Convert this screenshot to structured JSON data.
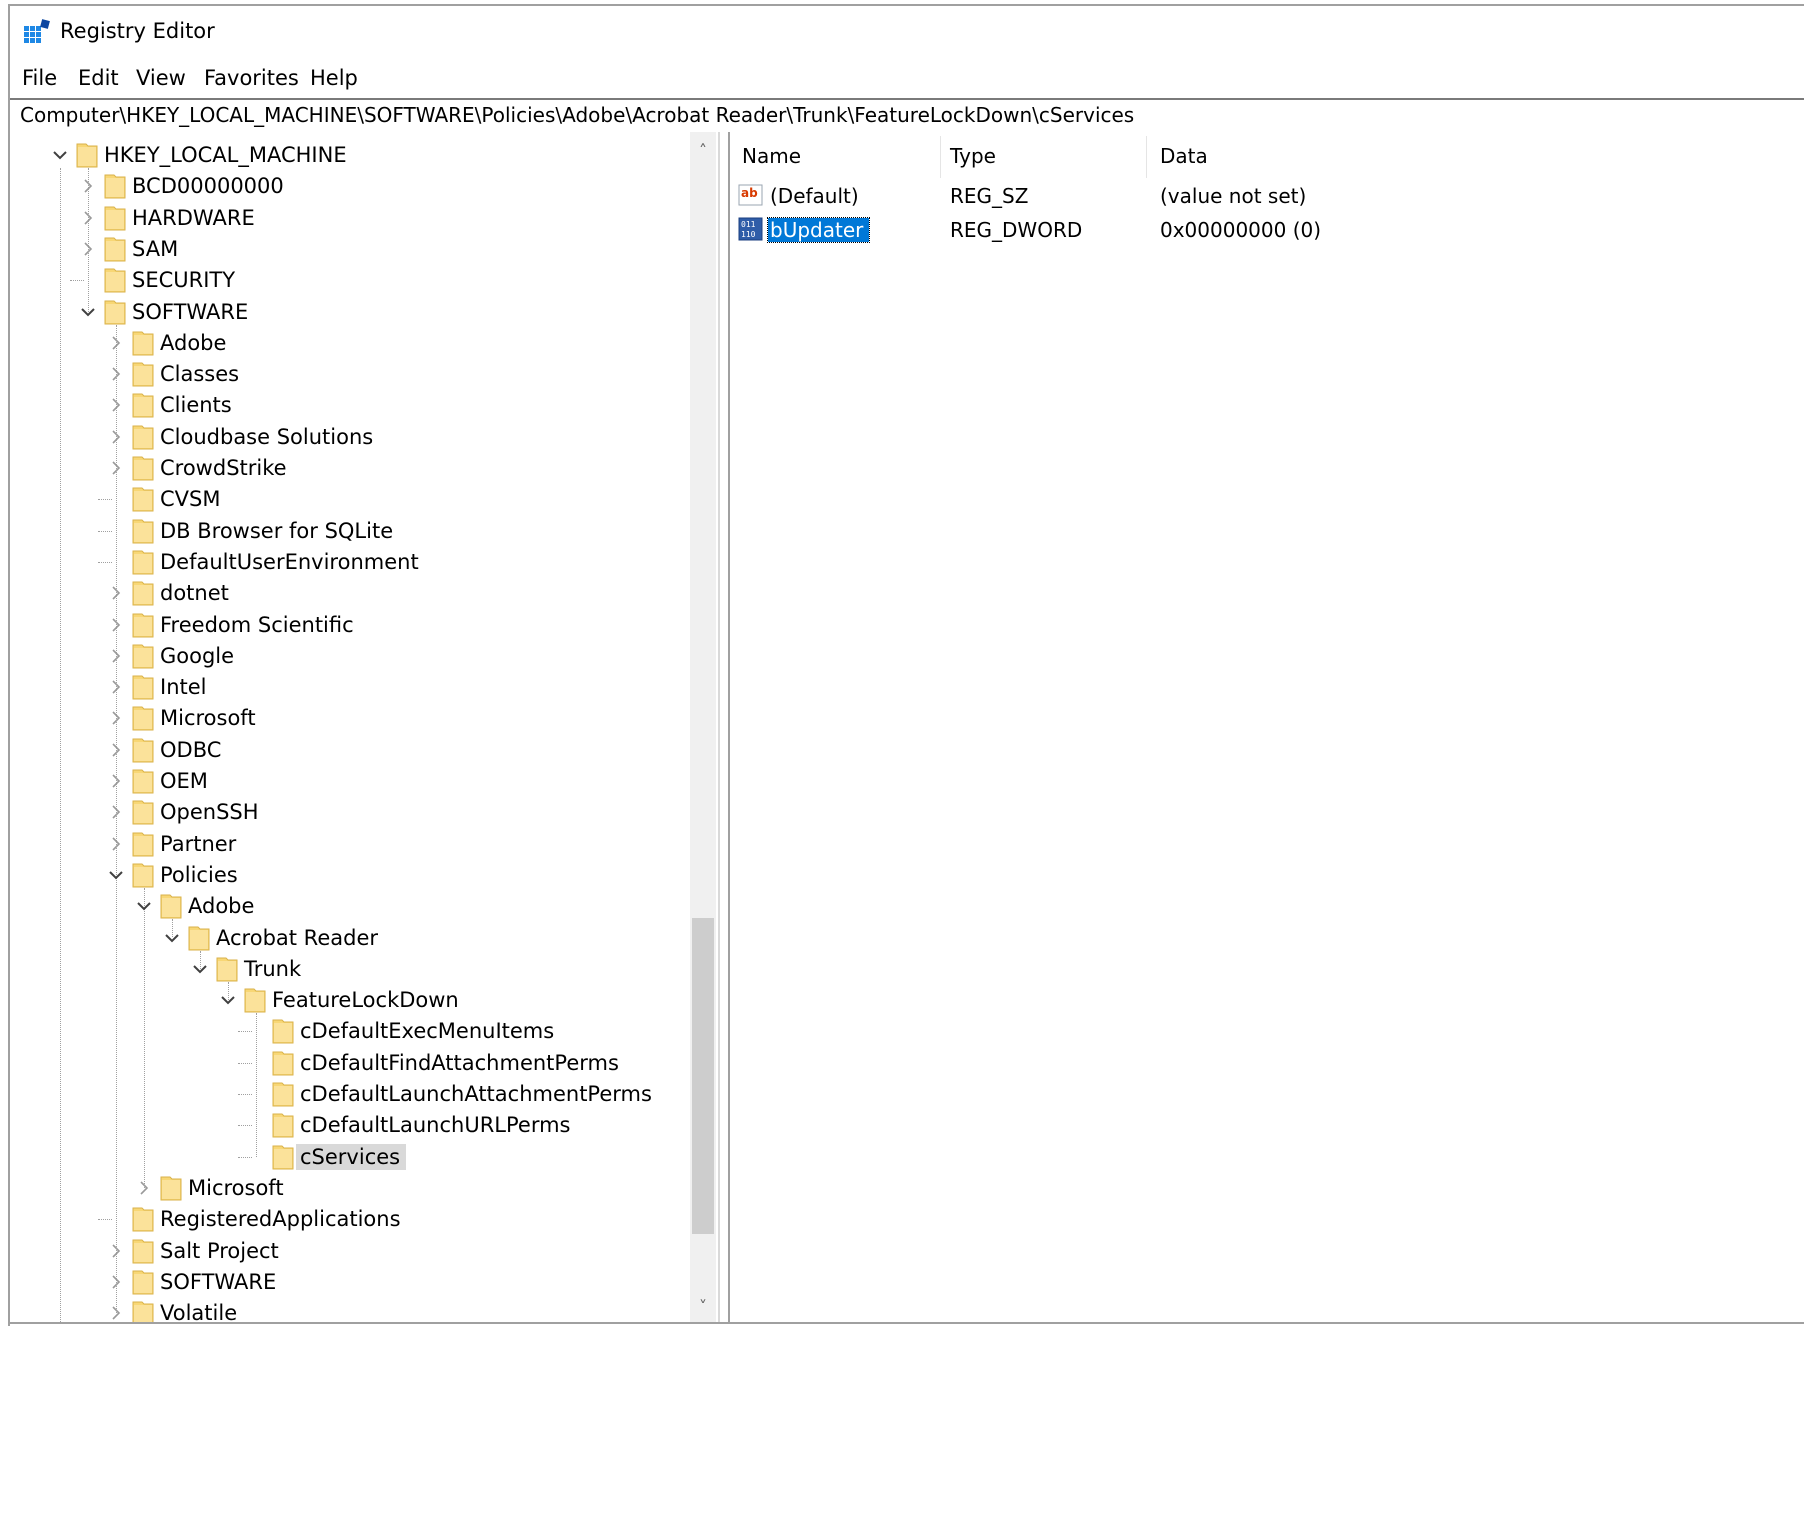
{
  "window": {
    "title": "Registry Editor"
  },
  "menu": [
    "File",
    "Edit",
    "View",
    "Favorites",
    "Help"
  ],
  "address": "Computer\\HKEY_LOCAL_MACHINE\\SOFTWARE\\Policies\\Adobe\\Acrobat Reader\\Trunk\\FeatureLockDown\\cServices",
  "columns": {
    "name": "Name",
    "type": "Type",
    "data": "Data"
  },
  "values": [
    {
      "icon": "string-value-icon",
      "name": "(Default)",
      "type": "REG_SZ",
      "data": "(value not set)",
      "selected": false
    },
    {
      "icon": "dword-value-icon",
      "name": "bUpdater",
      "type": "REG_DWORD",
      "data": "0x00000000 (0)",
      "selected": true
    }
  ],
  "tree": [
    {
      "label": "HKEY_LOCAL_MACHINE",
      "depth": 0,
      "state": "expanded"
    },
    {
      "label": "BCD00000000",
      "depth": 1,
      "state": "collapsed"
    },
    {
      "label": "HARDWARE",
      "depth": 1,
      "state": "collapsed"
    },
    {
      "label": "SAM",
      "depth": 1,
      "state": "collapsed"
    },
    {
      "label": "SECURITY",
      "depth": 1,
      "state": "leaf"
    },
    {
      "label": "SOFTWARE",
      "depth": 1,
      "state": "expanded"
    },
    {
      "label": "Adobe",
      "depth": 2,
      "state": "collapsed"
    },
    {
      "label": "Classes",
      "depth": 2,
      "state": "collapsed"
    },
    {
      "label": "Clients",
      "depth": 2,
      "state": "collapsed"
    },
    {
      "label": "Cloudbase Solutions",
      "depth": 2,
      "state": "collapsed"
    },
    {
      "label": "CrowdStrike",
      "depth": 2,
      "state": "collapsed"
    },
    {
      "label": "CVSM",
      "depth": 2,
      "state": "leaf"
    },
    {
      "label": "DB Browser for SQLite",
      "depth": 2,
      "state": "leaf"
    },
    {
      "label": "DefaultUserEnvironment",
      "depth": 2,
      "state": "leaf"
    },
    {
      "label": "dotnet",
      "depth": 2,
      "state": "collapsed"
    },
    {
      "label": "Freedom Scientific",
      "depth": 2,
      "state": "collapsed"
    },
    {
      "label": "Google",
      "depth": 2,
      "state": "collapsed"
    },
    {
      "label": "Intel",
      "depth": 2,
      "state": "collapsed"
    },
    {
      "label": "Microsoft",
      "depth": 2,
      "state": "collapsed"
    },
    {
      "label": "ODBC",
      "depth": 2,
      "state": "collapsed"
    },
    {
      "label": "OEM",
      "depth": 2,
      "state": "collapsed"
    },
    {
      "label": "OpenSSH",
      "depth": 2,
      "state": "collapsed"
    },
    {
      "label": "Partner",
      "depth": 2,
      "state": "collapsed"
    },
    {
      "label": "Policies",
      "depth": 2,
      "state": "expanded"
    },
    {
      "label": "Adobe",
      "depth": 3,
      "state": "expanded"
    },
    {
      "label": "Acrobat Reader",
      "depth": 4,
      "state": "expanded"
    },
    {
      "label": "Trunk",
      "depth": 5,
      "state": "expanded"
    },
    {
      "label": "FeatureLockDown",
      "depth": 6,
      "state": "expanded"
    },
    {
      "label": "cDefaultExecMenuItems",
      "depth": 7,
      "state": "leaf"
    },
    {
      "label": "cDefaultFindAttachmentPerms",
      "depth": 7,
      "state": "leaf"
    },
    {
      "label": "cDefaultLaunchAttachmentPerms",
      "depth": 7,
      "state": "leaf"
    },
    {
      "label": "cDefaultLaunchURLPerms",
      "depth": 7,
      "state": "leaf"
    },
    {
      "label": "cServices",
      "depth": 7,
      "state": "leaf",
      "selected": true
    },
    {
      "label": "Microsoft",
      "depth": 3,
      "state": "collapsed"
    },
    {
      "label": "RegisteredApplications",
      "depth": 2,
      "state": "leaf"
    },
    {
      "label": "Salt Project",
      "depth": 2,
      "state": "collapsed"
    },
    {
      "label": "SOFTWARE",
      "depth": 2,
      "state": "collapsed"
    },
    {
      "label": "Volatile",
      "depth": 2,
      "state": "collapsed"
    }
  ],
  "colors": {
    "selection": "#0078d7",
    "tree_selection": "#d9d9d9",
    "folder": "#f8d775"
  }
}
